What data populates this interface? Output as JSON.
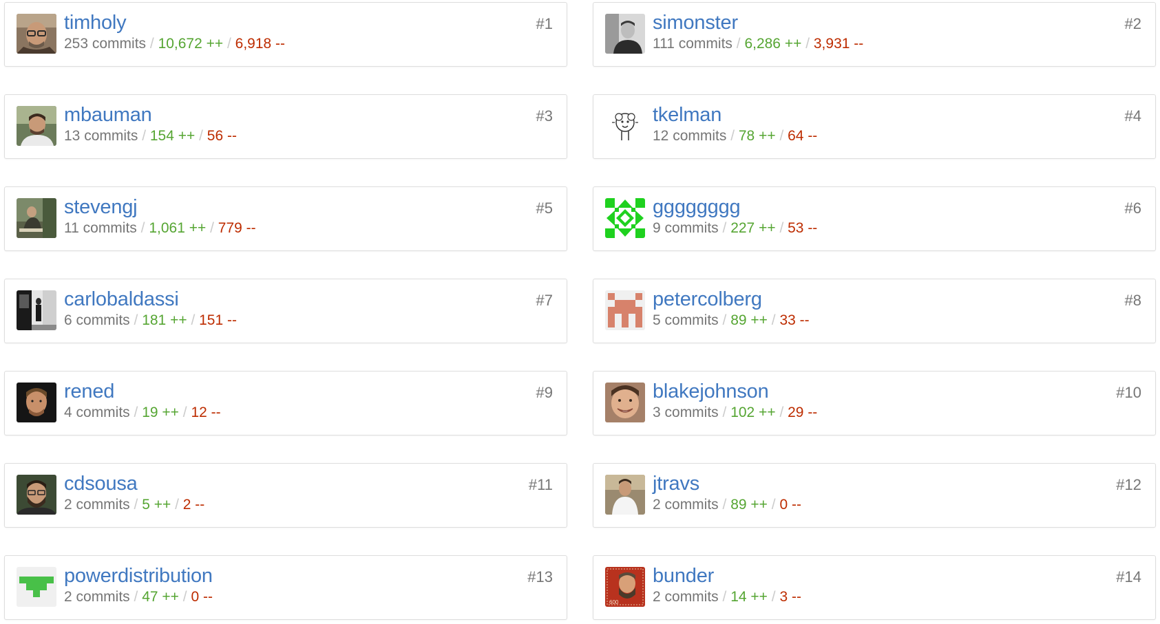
{
  "colors": {
    "link": "#4078c0",
    "additions": "#55a532",
    "deletions": "#bd2c00",
    "muted": "#767676",
    "border": "#dddddd"
  },
  "contributors": [
    {
      "rank": "#1",
      "username": "timholy",
      "commits": "253 commits",
      "additions": "10,672 ++",
      "deletions": "6,918 --",
      "avatar": "photo-man-glasses"
    },
    {
      "rank": "#2",
      "username": "simonster",
      "commits": "111 commits",
      "additions": "6,286 ++",
      "deletions": "3,931 --",
      "avatar": "photo-bw-man"
    },
    {
      "rank": "#3",
      "username": "mbauman",
      "commits": "13 commits",
      "additions": "154 ++",
      "deletions": "56 --",
      "avatar": "photo-man-outdoor"
    },
    {
      "rank": "#4",
      "username": "tkelman",
      "commits": "12 commits",
      "additions": "78 ++",
      "deletions": "64 --",
      "avatar": "sheep-drawing"
    },
    {
      "rank": "#5",
      "username": "stevengj",
      "commits": "11 commits",
      "additions": "1,061 ++",
      "deletions": "779 --",
      "avatar": "photo-man-sitting"
    },
    {
      "rank": "#6",
      "username": "gggggggg",
      "commits": "9 commits",
      "additions": "227 ++",
      "deletions": "53 --",
      "avatar": "identicon-green"
    },
    {
      "rank": "#7",
      "username": "carlobaldassi",
      "commits": "6 commits",
      "additions": "181 ++",
      "deletions": "151 --",
      "avatar": "photo-bw-street"
    },
    {
      "rank": "#8",
      "username": "petercolberg",
      "commits": "5 commits",
      "additions": "89 ++",
      "deletions": "33 --",
      "avatar": "identicon-salmon"
    },
    {
      "rank": "#9",
      "username": "rened",
      "commits": "4 commits",
      "additions": "19 ++",
      "deletions": "12 --",
      "avatar": "photo-man-dark"
    },
    {
      "rank": "#10",
      "username": "blakejohnson",
      "commits": "3 commits",
      "additions": "102 ++",
      "deletions": "29 --",
      "avatar": "photo-man-smile"
    },
    {
      "rank": "#11",
      "username": "cdsousa",
      "commits": "2 commits",
      "additions": "5 ++",
      "deletions": "2 --",
      "avatar": "photo-man-beard"
    },
    {
      "rank": "#12",
      "username": "jtravs",
      "commits": "2 commits",
      "additions": "89 ++",
      "deletions": "0 --",
      "avatar": "photo-man-outdoor-white"
    },
    {
      "rank": "#13",
      "username": "powerdistribution",
      "commits": "2 commits",
      "additions": "47 ++",
      "deletions": "0 --",
      "avatar": "identicon-green-light"
    },
    {
      "rank": "#14",
      "username": "bunder",
      "commits": "2 commits",
      "additions": "14 ++",
      "deletions": "3 --",
      "avatar": "stamp-portrait"
    }
  ]
}
